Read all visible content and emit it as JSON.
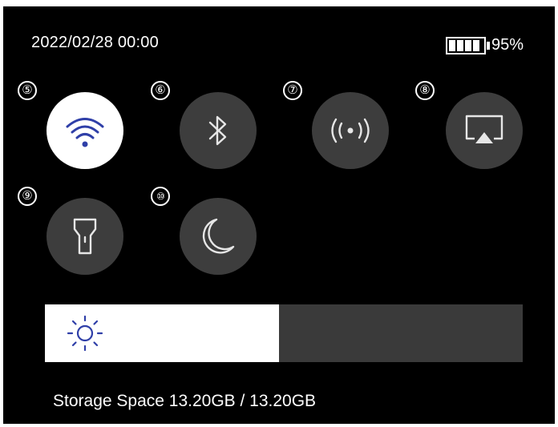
{
  "status_bar": {
    "datetime": "2022/02/28 00:00",
    "battery_percent": "95%"
  },
  "tiles": [
    {
      "number": "⑤",
      "name": "wifi",
      "icon": "wifi-icon",
      "active": true
    },
    {
      "number": "⑥",
      "name": "bluetooth",
      "icon": "bluetooth-icon",
      "active": false
    },
    {
      "number": "⑦",
      "name": "hotspot",
      "icon": "hotspot-icon",
      "active": false
    },
    {
      "number": "⑧",
      "name": "screen-cast",
      "icon": "screen-cast-icon",
      "active": false
    },
    {
      "number": "⑨",
      "name": "flashlight",
      "icon": "flashlight-icon",
      "active": false
    },
    {
      "number": "⑩",
      "name": "night-mode",
      "icon": "moon-icon",
      "active": false
    }
  ],
  "brightness": {
    "icon": "sun-icon",
    "level": 0.49
  },
  "storage": {
    "text": "Storage Space 13.20GB / 13.20GB"
  },
  "colors": {
    "background": "#000000",
    "tile": "#3d3d3d",
    "active_tile": "#ffffff",
    "accent": "#2f3fa8"
  }
}
